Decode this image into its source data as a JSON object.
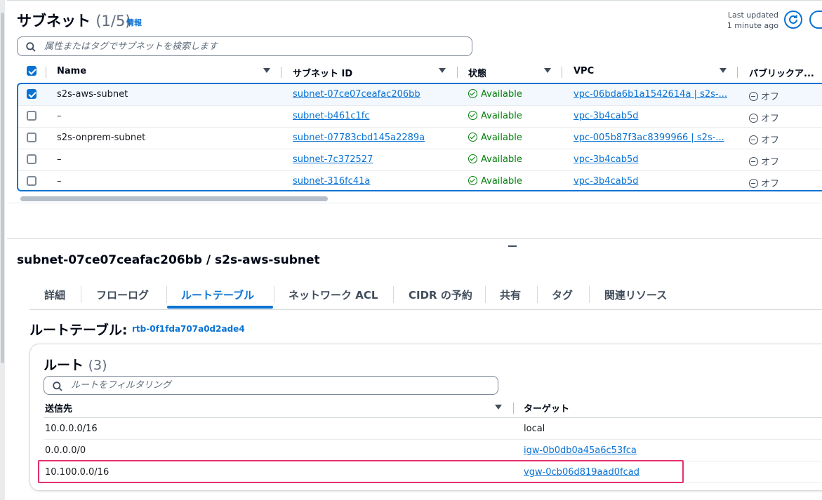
{
  "subnets_panel": {
    "title": "サブネット",
    "count": "(1/5)",
    "info_link": "情報",
    "last_updated": [
      "Last updated",
      "1 minute ago"
    ],
    "search_placeholder": "属性またはタグでサブネットを検索します",
    "columns": [
      "Name",
      "サブネット ID",
      "状態",
      "VPC",
      "パブリックア..."
    ],
    "rows": [
      {
        "selected": true,
        "name": "s2s-aws-subnet",
        "subnet_id": "subnet-07ce07ceafac206bb",
        "state": "Available",
        "vpc": "vpc-06bda6b1a1542614a | s2s-...",
        "public": "オフ"
      },
      {
        "selected": false,
        "name": "–",
        "subnet_id": "subnet-b461c1fc",
        "state": "Available",
        "vpc": "vpc-3b4cab5d",
        "public": "オフ"
      },
      {
        "selected": false,
        "name": "s2s-onprem-subnet",
        "subnet_id": "subnet-07783cbd145a2289a",
        "state": "Available",
        "vpc": "vpc-005b87f3ac8399966 | s2s-...",
        "public": "オフ"
      },
      {
        "selected": false,
        "name": "–",
        "subnet_id": "subnet-7c372527",
        "state": "Available",
        "vpc": "vpc-3b4cab5d",
        "public": "オフ"
      },
      {
        "selected": false,
        "name": "–",
        "subnet_id": "subnet-316fc41a",
        "state": "Available",
        "vpc": "vpc-3b4cab5d",
        "public": "オフ"
      }
    ]
  },
  "detail": {
    "title": "subnet-07ce07ceafac206bb / s2s-aws-subnet",
    "tabs": [
      "詳細",
      "フローログ",
      "ルートテーブル",
      "ネットワーク ACL",
      "CIDR の予約",
      "共有",
      "タグ",
      "関連リソース"
    ],
    "active_tab": "ルートテーブル",
    "route_table_label": "ルートテーブル:",
    "route_table_id": "rtb-0f1fda707a0d2ade4",
    "routes_title": "ルート",
    "routes_count": "(3)",
    "routes_search_placeholder": "ルートをフィルタリング",
    "routes_columns": [
      "送信先",
      "ターゲット"
    ],
    "routes": [
      {
        "destination": "10.0.0.0/16",
        "target": "local",
        "target_is_link": false
      },
      {
        "destination": "0.0.0.0/0",
        "target": "igw-0b0db0a45a6c53fca",
        "target_is_link": true
      },
      {
        "destination": "10.100.0.0/16",
        "target": "vgw-0cb06d819aad0fcad",
        "target_is_link": true
      }
    ]
  },
  "colors": {
    "link": "#0972d3",
    "available": "#037f0c",
    "highlight": "#e4306f"
  }
}
